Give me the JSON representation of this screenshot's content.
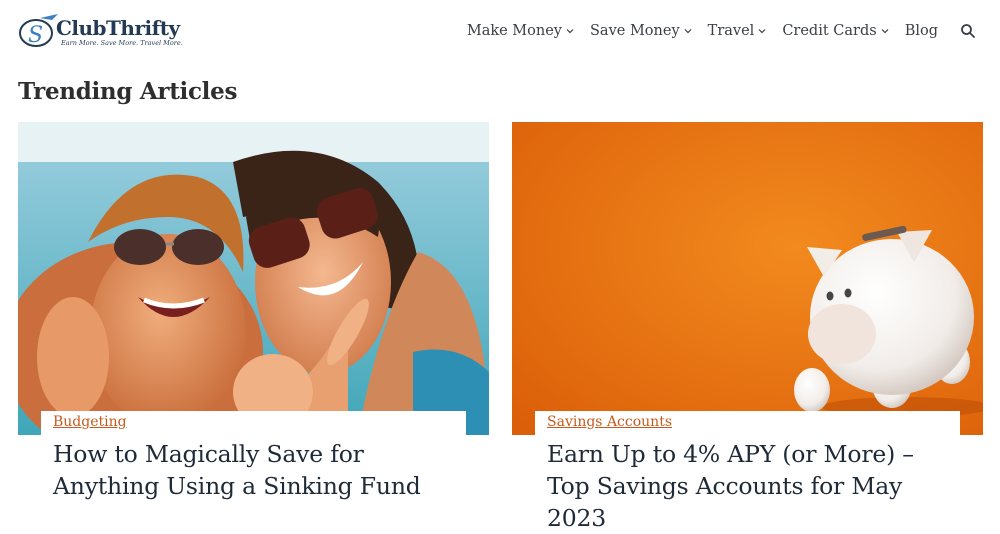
{
  "brand": {
    "name": "ClubThrifty",
    "tagline": "Earn More. Save More. Travel More."
  },
  "nav": {
    "items": [
      {
        "label": "Make Money",
        "dropdown": true
      },
      {
        "label": "Save Money",
        "dropdown": true
      },
      {
        "label": "Travel",
        "dropdown": true
      },
      {
        "label": "Credit Cards",
        "dropdown": true
      },
      {
        "label": "Blog",
        "dropdown": false
      }
    ],
    "search_icon": "search-icon"
  },
  "section": {
    "title": "Trending Articles"
  },
  "articles": [
    {
      "category": "Budgeting",
      "title": "How to Magically Save for Anything Using a Sinking Fund",
      "image": "couple-on-beach-thumbs-up"
    },
    {
      "category": "Savings Accounts",
      "title": "Earn Up to 4% APY (or More) – Top Savings Accounts for May 2023",
      "image": "white-piggy-bank-on-orange"
    }
  ],
  "colors": {
    "accent": "#c65a1e",
    "brand_navy": "#233a52",
    "orange_bg": "#e86e0c"
  }
}
